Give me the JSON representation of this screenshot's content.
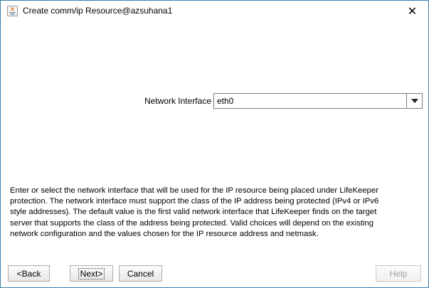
{
  "window": {
    "title": "Create comm/ip Resource@azsuhana1",
    "close_glyph": "✕"
  },
  "form": {
    "network_interface_label": "Network Interface",
    "network_interface_value": "eth0"
  },
  "help_text": {
    "lines": [
      "Enter or select the network interface that will be used for the IP resource being placed under LifeKeeper",
      "protection. The network interface must support the class of the IP address being protected (IPv4 or IPv6",
      "style addresses). The default value is the first valid network interface that LifeKeeper finds on the target",
      "server that supports the class of the address being protected. Valid choices will depend on the existing",
      "network configuration and the values chosen for the IP resource address and netmask."
    ]
  },
  "buttons": {
    "back": "<Back",
    "next": "Next>",
    "cancel": "Cancel",
    "help": "Help"
  },
  "icons": {
    "app": "java-app-icon",
    "close": "close-icon",
    "dropdown": "chevron-down-icon"
  }
}
